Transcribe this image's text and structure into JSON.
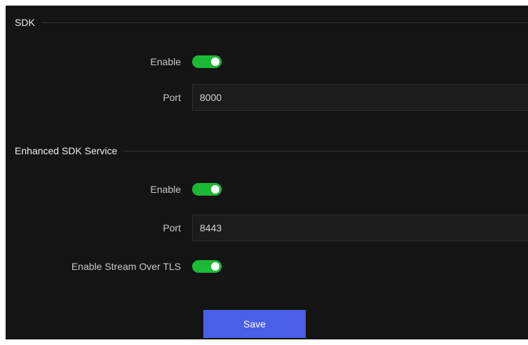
{
  "sections": [
    {
      "title": "SDK",
      "enable_label": "Enable",
      "enable_on": true,
      "port_label": "Port",
      "port_value": "8000"
    },
    {
      "title": "Enhanced SDK Service",
      "enable_label": "Enable",
      "enable_on": true,
      "port_label": "Port",
      "port_value": "8443",
      "tls_label": "Enable Stream Over TLS",
      "tls_on": true
    }
  ],
  "save_label": "Save",
  "colors": {
    "toggle_on": "#1bb934",
    "button": "#4a5ee6",
    "background": "#141414"
  }
}
